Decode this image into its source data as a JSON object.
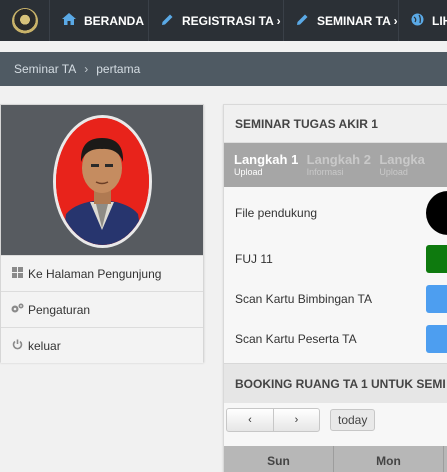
{
  "nav": {
    "items": [
      {
        "label": "BERANDA",
        "icon": "home-icon"
      },
      {
        "label": "REGISTRASI TA ›",
        "icon": "pencil-icon"
      },
      {
        "label": "SEMINAR TA ›",
        "icon": "pencil-icon"
      },
      {
        "label": "LIH",
        "icon": "globe-icon"
      }
    ]
  },
  "breadcrumb": {
    "items": [
      "Seminar TA",
      "pertama"
    ],
    "separator": "›"
  },
  "profile": {
    "menu": [
      {
        "label": "Ke Halaman Pengunjung",
        "icon": "windows-icon"
      },
      {
        "label": "Pengaturan",
        "icon": "cogs-icon"
      },
      {
        "label": "keluar",
        "icon": "power-icon"
      }
    ]
  },
  "seminar": {
    "title": "SEMINAR TUGAS AKIR 1",
    "steps": [
      {
        "title": "Langkah 1",
        "subtitle": "Upload",
        "active": true
      },
      {
        "title": "Langkah 2",
        "subtitle": "Informasi",
        "active": false
      },
      {
        "title": "Langka",
        "subtitle": "Upload",
        "active": false
      }
    ],
    "fields": [
      {
        "label": "File pendukung",
        "color": "#000000"
      },
      {
        "label": "FUJ 11",
        "color": "#0e7a0e"
      },
      {
        "label": "Scan Kartu Bimbingan TA",
        "color": "#4d9ef0"
      },
      {
        "label": "Scan Kartu Peserta TA",
        "color": "#4d9ef0"
      }
    ]
  },
  "booking": {
    "title": "BOOKING RUANG TA 1 UNTUK SEMI",
    "prev_label": "‹",
    "next_label": "›",
    "today_label": "today",
    "days": [
      "Sun",
      "Mon"
    ]
  },
  "colors": {
    "navbar": "#2b3036",
    "nav_icon": "#5aa9e6",
    "breadcrumb_bar": "#4f5a63",
    "steps_bar": "#a6a6a6"
  }
}
